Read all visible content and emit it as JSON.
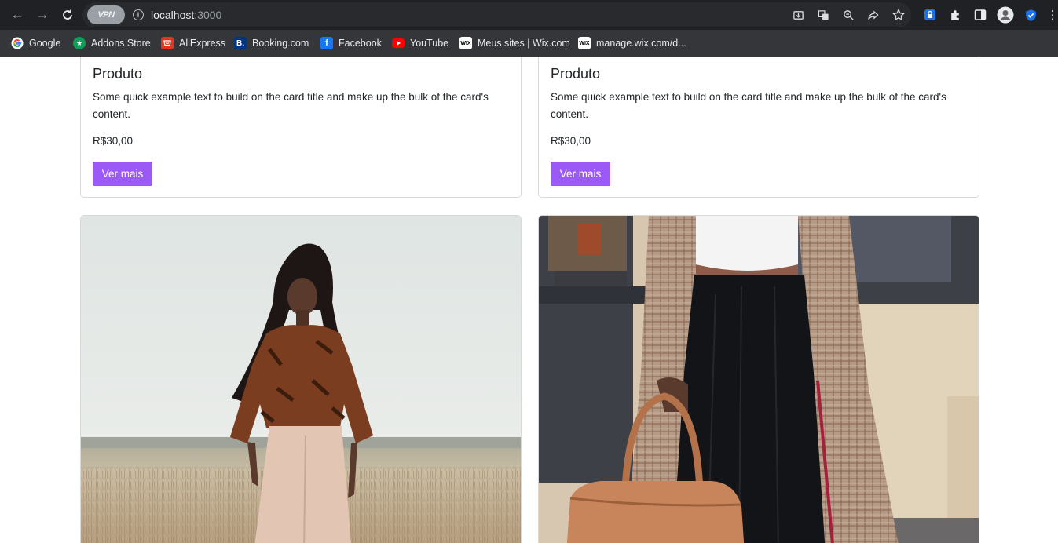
{
  "browser": {
    "vpn_label": "VPN",
    "url_host": "localhost",
    "url_port": ":3000"
  },
  "bookmarks": [
    {
      "label": "Google",
      "icon": "google-icon",
      "color": "#ffffff"
    },
    {
      "label": "Addons Store",
      "icon": "addons-store-icon",
      "color": "#0f9d58"
    },
    {
      "label": "AliExpress",
      "icon": "aliexpress-icon",
      "color": "#e43225"
    },
    {
      "label": "Booking.com",
      "icon": "booking-icon",
      "color": "#003580"
    },
    {
      "label": "Facebook",
      "icon": "facebook-icon",
      "color": "#1877f2"
    },
    {
      "label": "YouTube",
      "icon": "youtube-icon",
      "color": "#ff0000"
    },
    {
      "label": "Meus sites | Wix.com",
      "icon": "wix-icon",
      "color": "#ffffff"
    },
    {
      "label": "manage.wix.com/d...",
      "icon": "wix-icon",
      "color": "#ffffff"
    }
  ],
  "products": [
    {
      "title": "Produto",
      "description": "Some quick example text to build on the card title and make up the bulk of the card's content.",
      "price": "R$30,00",
      "button_label": "Ver mais"
    },
    {
      "title": "Produto",
      "description": "Some quick example text to build on the card title and make up the bulk of the card's content.",
      "price": "R$30,00",
      "button_label": "Ver mais"
    }
  ],
  "colors": {
    "accent_button": "#9b59f5",
    "chrome_dark": "#202124",
    "bookmarks_bar": "#35363a"
  }
}
